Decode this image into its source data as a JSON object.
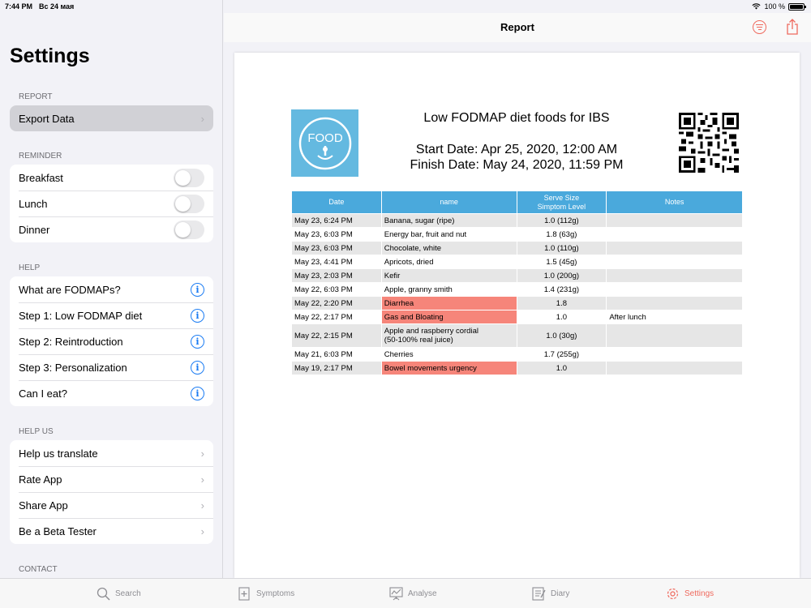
{
  "status": {
    "time": "7:44 PM",
    "date": "Вс 24 мая",
    "battery": "100 %"
  },
  "sidebar": {
    "title": "Settings",
    "sections": {
      "report": {
        "label": "REPORT",
        "items": [
          "Export Data"
        ]
      },
      "reminder": {
        "label": "REMINDER",
        "items": [
          "Breakfast",
          "Lunch",
          "Dinner"
        ]
      },
      "help": {
        "label": "HELP",
        "items": [
          "What are FODMAPs?",
          "Step 1: Low FODMAP diet",
          "Step 2: Reintroduction",
          "Step 3: Personalization",
          "Can I eat?"
        ]
      },
      "helpus": {
        "label": "HELP US",
        "items": [
          "Help us translate",
          "Rate App",
          "Share App",
          "Be a Beta Tester"
        ]
      },
      "contact": {
        "label": "CONTACT"
      }
    }
  },
  "nav": {
    "title": "Report"
  },
  "report": {
    "logo_text": "FOOD",
    "title": "Low FODMAP diet foods for IBS",
    "start": "Start Date: Apr 25, 2020, 12:00 AM",
    "finish": "Finish Date: May 24, 2020, 11:59 PM",
    "columns": {
      "date": "Date",
      "name": "name",
      "serve1": "Serve Size",
      "serve2": "Simptom Level",
      "notes": "Notes"
    },
    "rows": [
      {
        "date": "May 23, 6:24 PM",
        "name": "Banana, sugar (ripe)",
        "serve": "1.0 (112g)",
        "notes": ""
      },
      {
        "date": "May 23, 6:03 PM",
        "name": "Energy bar, fruit and nut",
        "serve": "1.8 (63g)",
        "notes": ""
      },
      {
        "date": "May 23, 6:03 PM",
        "name": "Chocolate, white",
        "serve": "1.0 (110g)",
        "notes": ""
      },
      {
        "date": "May 23, 4:41 PM",
        "name": "Apricots, dried",
        "serve": "1.5 (45g)",
        "notes": ""
      },
      {
        "date": "May 23, 2:03 PM",
        "name": "Kefir",
        "serve": "1.0 (200g)",
        "notes": ""
      },
      {
        "date": "May 22, 6:03 PM",
        "name": "Apple, granny smith",
        "serve": "1.4 (231g)",
        "notes": ""
      },
      {
        "date": "May 22, 2:20 PM",
        "name": "Diarrhea",
        "serve": "1.8",
        "notes": ""
      },
      {
        "date": "May 22, 2:17 PM",
        "name": "Gas and Bloating",
        "serve": "1.0",
        "notes": "After lunch"
      },
      {
        "date": "May 22, 2:15 PM",
        "name": "Apple and raspberry cordial",
        "name2": "(50-100% real juice)",
        "serve": "1.0 (30g)",
        "notes": ""
      },
      {
        "date": "May 21, 6:03 PM",
        "name": "Cherries",
        "serve": "1.7 (255g)",
        "notes": ""
      },
      {
        "date": "May 19, 2:17 PM",
        "name": "Bowel movements urgency",
        "serve": "1.0",
        "notes": ""
      }
    ]
  },
  "tabs": [
    "Search",
    "Symptoms",
    "Analyse",
    "Diary",
    "Settings"
  ],
  "colors": {
    "accent": "#ef6a5e",
    "info": "#1b7cf3",
    "table_header": "#4aa9dc",
    "symptom": "#f6857a",
    "logo": "#64b9e0"
  }
}
